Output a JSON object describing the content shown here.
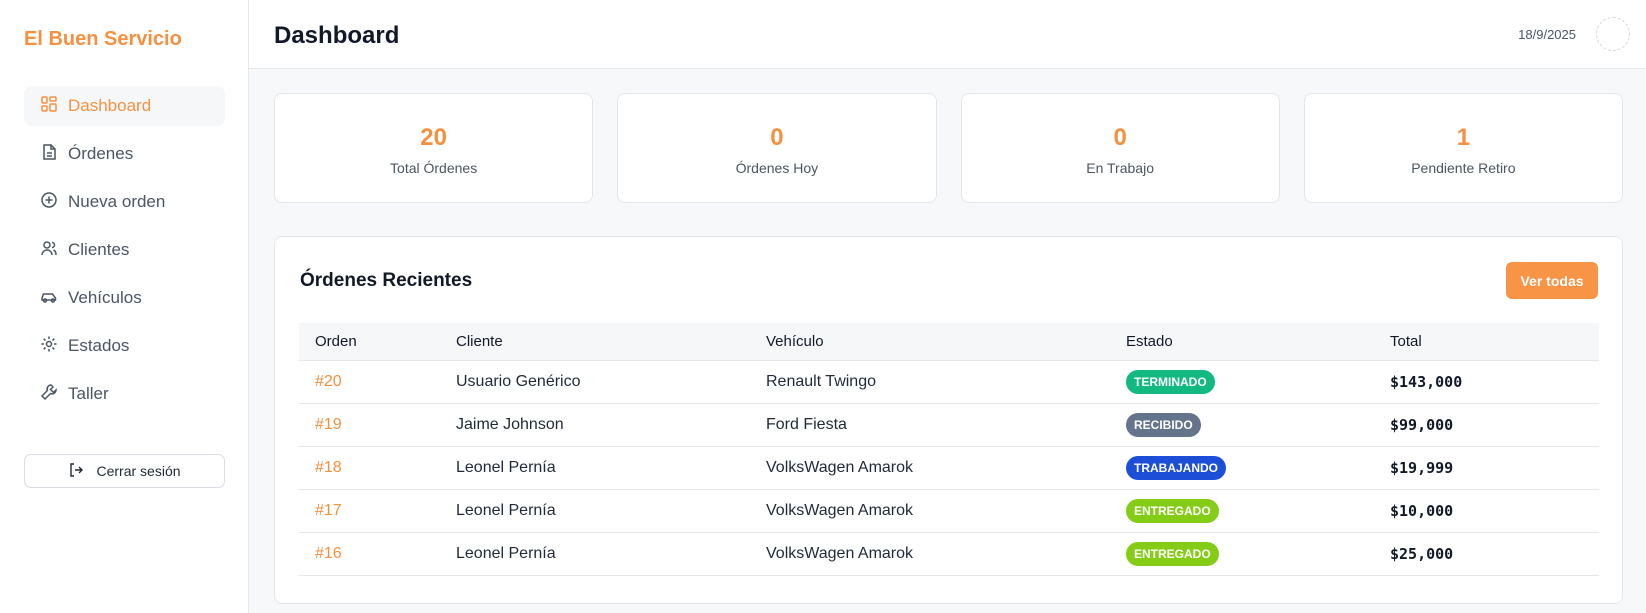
{
  "sidebar": {
    "brand": "El Buen Servicio",
    "items": [
      {
        "label": "Dashboard",
        "icon": "dashboard-icon",
        "active": true
      },
      {
        "label": "Órdenes",
        "icon": "document-icon",
        "active": false
      },
      {
        "label": "Nueva orden",
        "icon": "plus-circle-icon",
        "active": false
      },
      {
        "label": "Clientes",
        "icon": "users-icon",
        "active": false
      },
      {
        "label": "Vehículos",
        "icon": "car-icon",
        "active": false
      },
      {
        "label": "Estados",
        "icon": "gear-icon",
        "active": false
      },
      {
        "label": "Taller",
        "icon": "wrench-icon",
        "active": false
      }
    ],
    "logout_label": "Cerrar sesión"
  },
  "header": {
    "title": "Dashboard",
    "date": "18/9/2025"
  },
  "stats": [
    {
      "value": "20",
      "label": "Total Órdenes"
    },
    {
      "value": "0",
      "label": "Órdenes Hoy"
    },
    {
      "value": "0",
      "label": "En Trabajo"
    },
    {
      "value": "1",
      "label": "Pendiente Retiro"
    }
  ],
  "recent_orders": {
    "title": "Órdenes Recientes",
    "view_all_label": "Ver todas",
    "columns": [
      "Orden",
      "Cliente",
      "Vehículo",
      "Estado",
      "Total"
    ],
    "rows": [
      {
        "id": "#20",
        "client": "Usuario Genérico",
        "vehicle": "Renault Twingo",
        "status": "TERMINADO",
        "total": "$143,000"
      },
      {
        "id": "#19",
        "client": "Jaime Johnson",
        "vehicle": "Ford Fiesta",
        "status": "RECIBIDO",
        "total": "$99,000"
      },
      {
        "id": "#18",
        "client": "Leonel Pernía",
        "vehicle": "VolksWagen Amarok",
        "status": "TRABAJANDO",
        "total": "$19,999"
      },
      {
        "id": "#17",
        "client": "Leonel Pernía",
        "vehicle": "VolksWagen Amarok",
        "status": "ENTREGADO",
        "total": "$10,000"
      },
      {
        "id": "#16",
        "client": "Leonel Pernía",
        "vehicle": "VolksWagen Amarok",
        "status": "ENTREGADO",
        "total": "$25,000"
      }
    ]
  },
  "colors": {
    "accent": "#f5903e",
    "status": {
      "TERMINADO": "#12b981",
      "RECIBIDO": "#64748b",
      "TRABAJANDO": "#1d4ed8",
      "ENTREGADO": "#84cc16"
    }
  }
}
